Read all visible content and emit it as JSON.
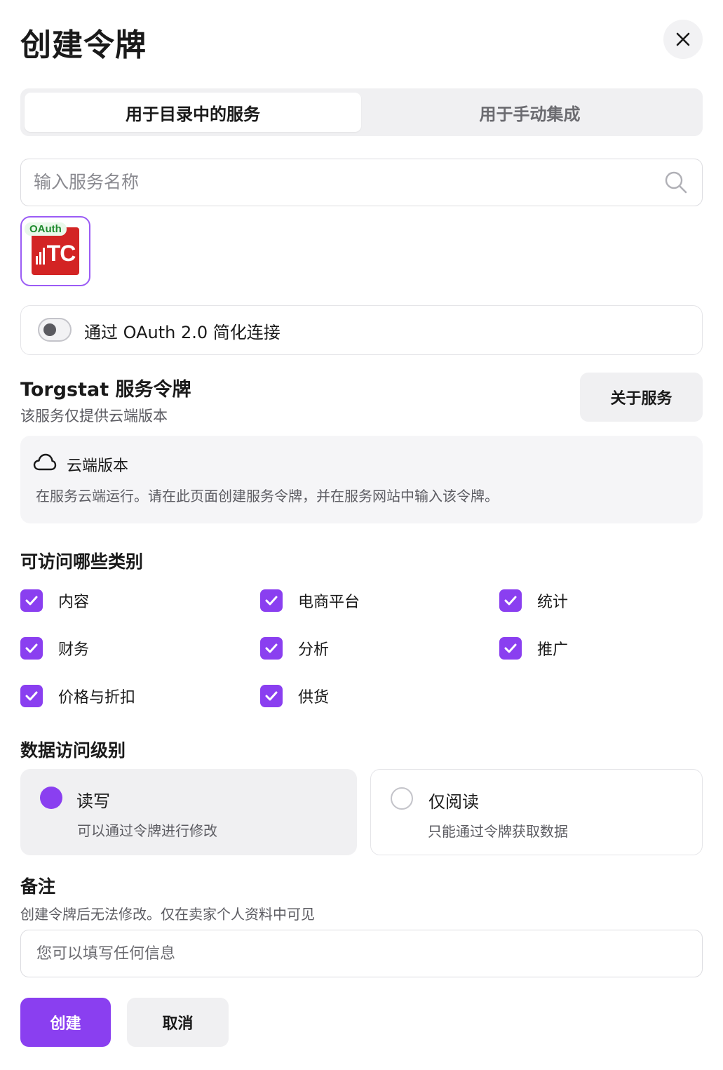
{
  "dialog": {
    "title": "创建令牌",
    "close_icon": "close-icon"
  },
  "tabs": [
    {
      "label": "用于目录中的服务",
      "active": true
    },
    {
      "label": "用于手动集成",
      "active": false
    }
  ],
  "search": {
    "placeholder": "输入服务名称",
    "value": "",
    "icon": "search-icon"
  },
  "service": {
    "badge": "OAuth",
    "logo_text": "TC",
    "logo_color": "#d32424"
  },
  "oauth_toggle": {
    "label": "通过 OAuth 2.0 简化连接",
    "enabled": false
  },
  "service_info": {
    "title": "Torgstat 服务令牌",
    "subtitle": "该服务仅提供云端版本",
    "about_button": "关于服务"
  },
  "cloud": {
    "icon": "cloud-icon",
    "title": "云端版本",
    "description": "在服务云端运行。请在此页面创建服务令牌，并在服务网站中输入该令牌。"
  },
  "categories": {
    "title": "可访问哪些类别",
    "items": [
      {
        "label": "内容",
        "checked": true
      },
      {
        "label": "电商平台",
        "checked": true
      },
      {
        "label": "统计",
        "checked": true
      },
      {
        "label": "财务",
        "checked": true
      },
      {
        "label": "分析",
        "checked": true
      },
      {
        "label": "推广",
        "checked": true
      },
      {
        "label": "价格与折扣",
        "checked": true
      },
      {
        "label": "供货",
        "checked": true
      }
    ]
  },
  "access_level": {
    "title": "数据访问级别",
    "options": [
      {
        "title": "读写",
        "description": "可以通过令牌进行修改",
        "selected": true
      },
      {
        "title": "仅阅读",
        "description": "只能通过令牌获取数据",
        "selected": false
      }
    ]
  },
  "note": {
    "title": "备注",
    "subtitle": "创建令牌后无法修改。仅在卖家个人资料中可见",
    "placeholder": "您可以填写任何信息",
    "value": ""
  },
  "actions": {
    "create": "创建",
    "cancel": "取消"
  },
  "colors": {
    "accent": "#8a3ff0",
    "tile_border": "#9b5cf5",
    "badge_green": "#1f8a2e"
  }
}
